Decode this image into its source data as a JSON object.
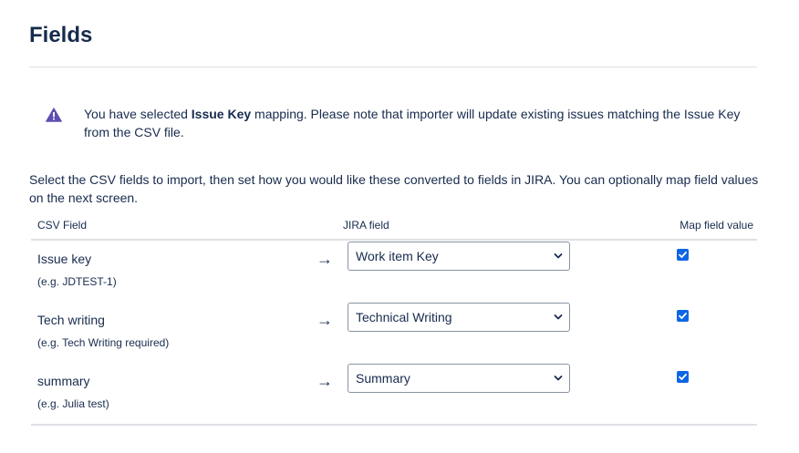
{
  "page": {
    "title": "Fields"
  },
  "warning": {
    "icon": "warning-triangle-icon",
    "icon_color": "#5e4db2",
    "text_before": "You have selected ",
    "text_bold": "Issue Key",
    "text_after": " mapping. Please note that importer will update existing issues matching the Issue Key from the CSV file."
  },
  "intro": {
    "text": "Select the CSV fields to import, then set how you would like these converted to fields in JIRA. You can optionally map field values on the next screen."
  },
  "table": {
    "headers": {
      "csv_field": "CSV Field",
      "jira_field": "JIRA field",
      "map_value": "Map field value"
    },
    "rows": [
      {
        "csv_name": "Issue key",
        "example": "(e.g. JDTEST-1)",
        "jira_field": "Work item Key",
        "map_value_checked": true
      },
      {
        "csv_name": "Tech writing",
        "example": "(e.g. Tech Writing required)",
        "jira_field": "Technical Writing",
        "map_value_checked": true
      },
      {
        "csv_name": "summary",
        "example": "(e.g. Julia test)",
        "jira_field": "Summary",
        "map_value_checked": true
      }
    ]
  },
  "colors": {
    "text": "#172b4d",
    "checkbox": "#0c66e4",
    "divider": "#dfe1e6"
  }
}
